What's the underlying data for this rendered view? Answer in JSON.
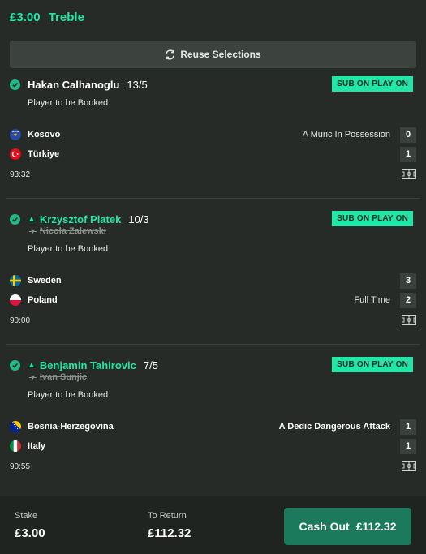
{
  "header": {
    "stake": "£3.00",
    "bet_type": "Treble"
  },
  "reuse_button": {
    "label": "Reuse Selections",
    "icon": "refresh-icon"
  },
  "selections": [
    {
      "player": "Hakan Calhanoglu",
      "odds": "13/5",
      "badge": "SUB ON PLAY ON",
      "market": "Player to be Booked",
      "home": {
        "team": "Kosovo",
        "score": "0"
      },
      "away": {
        "team": "Türkiye",
        "score": "1"
      },
      "event": "A Muric In Possession",
      "time": "93:32"
    },
    {
      "player": "Krzysztof Piatek",
      "replaced_player": "Nicola Zalewski",
      "odds": "10/3",
      "badge": "SUB ON PLAY ON",
      "market": "Player to be Booked",
      "home": {
        "team": "Sweden",
        "score": "3"
      },
      "away": {
        "team": "Poland",
        "score": "2"
      },
      "event": "Full Time",
      "time": "90:00"
    },
    {
      "player": "Benjamin Tahirovic",
      "replaced_player": "Ivan Sunjic",
      "odds": "7/5",
      "badge": "SUB ON PLAY ON",
      "market": "Player to be Booked",
      "home": {
        "team": "Bosnia-Herzegovina",
        "score": "1"
      },
      "away": {
        "team": "Italy",
        "score": "1"
      },
      "event": "A Dedic Dangerous Attack",
      "time": "90:55"
    }
  ],
  "footer": {
    "stake_label": "Stake",
    "stake_value": "£3.00",
    "return_label": "To Return",
    "return_value": "£112.32",
    "cashout_label": "Cash Out",
    "cashout_value": "£112.32"
  },
  "colors": {
    "accent": "#20e6a8",
    "background": "#262b27",
    "cashout": "#1b7a5c"
  }
}
